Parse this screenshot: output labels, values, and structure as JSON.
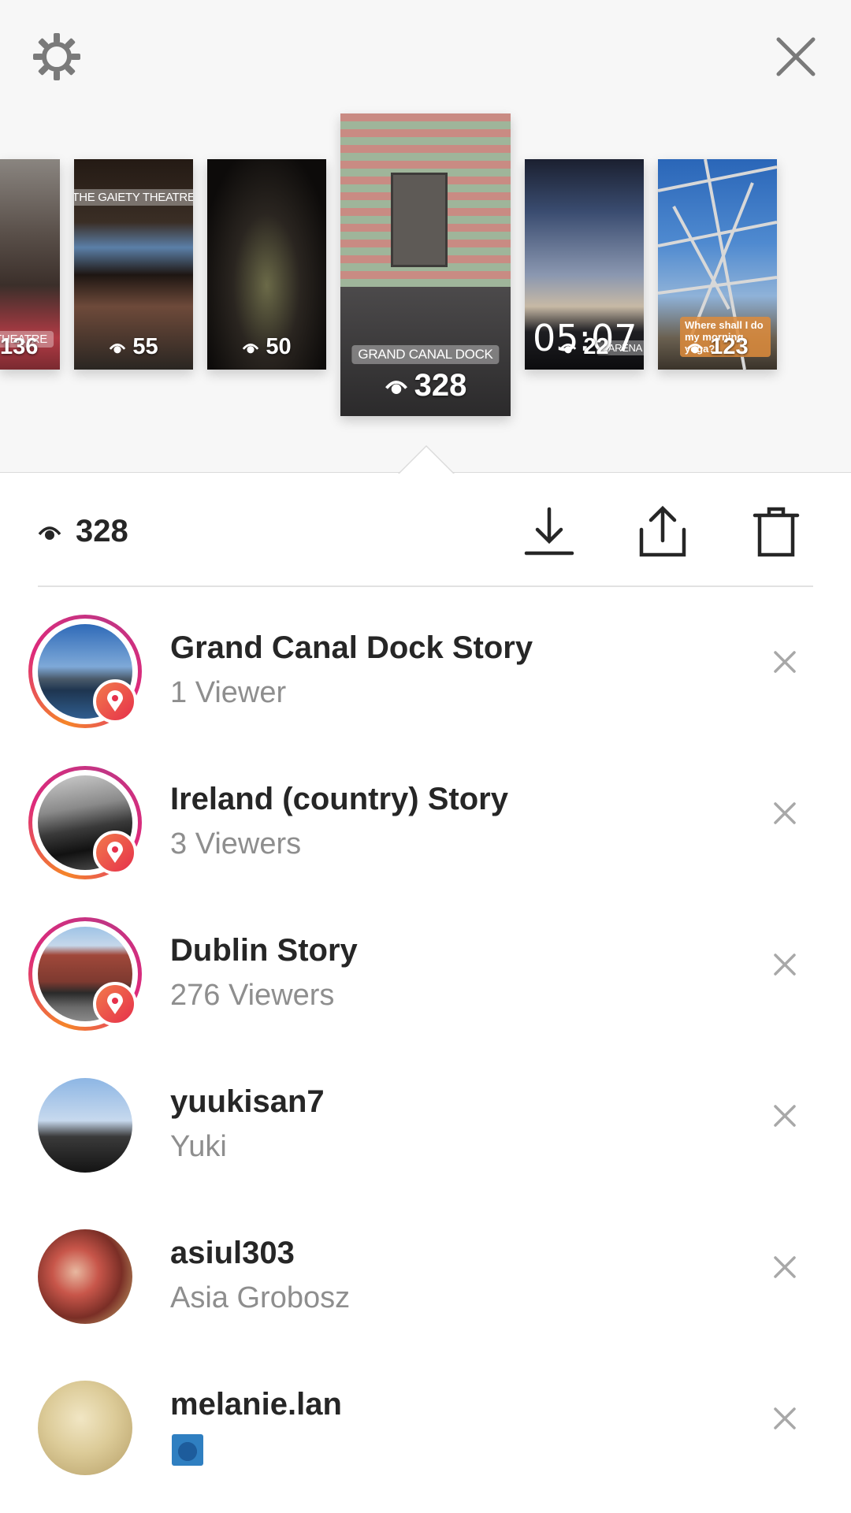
{
  "header": {
    "settings_icon": "gear-icon",
    "close_icon": "close-icon"
  },
  "stories": [
    {
      "views": "136",
      "tag": "Y THEATRE",
      "partial": true
    },
    {
      "views": "55",
      "tag": "THE GAIETY THEATRE"
    },
    {
      "views": "50",
      "tag": ""
    },
    {
      "views": "328",
      "tag": "GRAND CANAL DOCK",
      "selected": true
    },
    {
      "views": "22",
      "time": "05:07",
      "tag": "3ARENA"
    },
    {
      "views": "123",
      "caption": "Where shall I do my morning yoga?"
    }
  ],
  "stats": {
    "view_count": "328",
    "download_icon": "download-icon",
    "share_icon": "share-icon",
    "delete_icon": "trash-icon"
  },
  "viewers": [
    {
      "title": "Grand Canal Dock Story",
      "subtitle": "1 Viewer",
      "type": "location"
    },
    {
      "title": "Ireland (country) Story",
      "subtitle": "3 Viewers",
      "type": "location"
    },
    {
      "title": "Dublin Story",
      "subtitle": "276 Viewers",
      "type": "location"
    },
    {
      "title": "yuukisan7",
      "subtitle": "Yuki",
      "type": "user"
    },
    {
      "title": "asiul303",
      "subtitle": "Asia Grobosz",
      "type": "user"
    },
    {
      "title": "melanie.lan",
      "subtitle": "",
      "type": "user"
    }
  ],
  "colors": {
    "accent_gradient_start": "#f58529",
    "accent_gradient_end": "#c13584",
    "text_primary": "#262626",
    "text_secondary": "#8e8e8e"
  }
}
